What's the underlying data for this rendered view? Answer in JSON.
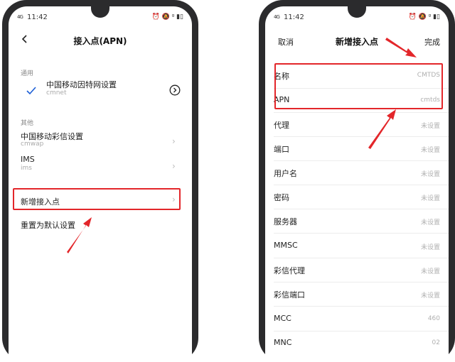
{
  "status": {
    "time": "11:42",
    "signal": "4G",
    "right_icons": "⏰ 🔕 ᵍ ▮▯"
  },
  "left": {
    "title": "接入点(APN)",
    "section_general": "通用",
    "general_item": {
      "name": "中国移动因特网设置",
      "sub": "cmnet"
    },
    "section_other": "其他",
    "other_items": [
      {
        "name": "中国移动彩信设置",
        "sub": "cmwap"
      },
      {
        "name": "IMS",
        "sub": "ims"
      }
    ],
    "add_apn": "新增接入点",
    "reset": "重置为默认设置"
  },
  "right": {
    "cancel": "取消",
    "title": "新增接入点",
    "done": "完成",
    "fields": [
      {
        "label": "名称",
        "value": "CMTDS"
      },
      {
        "label": "APN",
        "value": "cmtds"
      },
      {
        "label": "代理",
        "value": "未设置"
      },
      {
        "label": "端口",
        "value": "未设置"
      },
      {
        "label": "用户名",
        "value": "未设置"
      },
      {
        "label": "密码",
        "value": "未设置"
      },
      {
        "label": "服务器",
        "value": "未设置"
      },
      {
        "label": "MMSC",
        "value": "未设置"
      },
      {
        "label": "彩信代理",
        "value": "未设置"
      },
      {
        "label": "彩信端口",
        "value": "未设置"
      },
      {
        "label": "MCC",
        "value": "460"
      },
      {
        "label": "MNC",
        "value": "02"
      }
    ]
  },
  "colors": {
    "highlight": "#e3262a",
    "check": "#1d5fd6",
    "frame": "#2b2b2d"
  }
}
